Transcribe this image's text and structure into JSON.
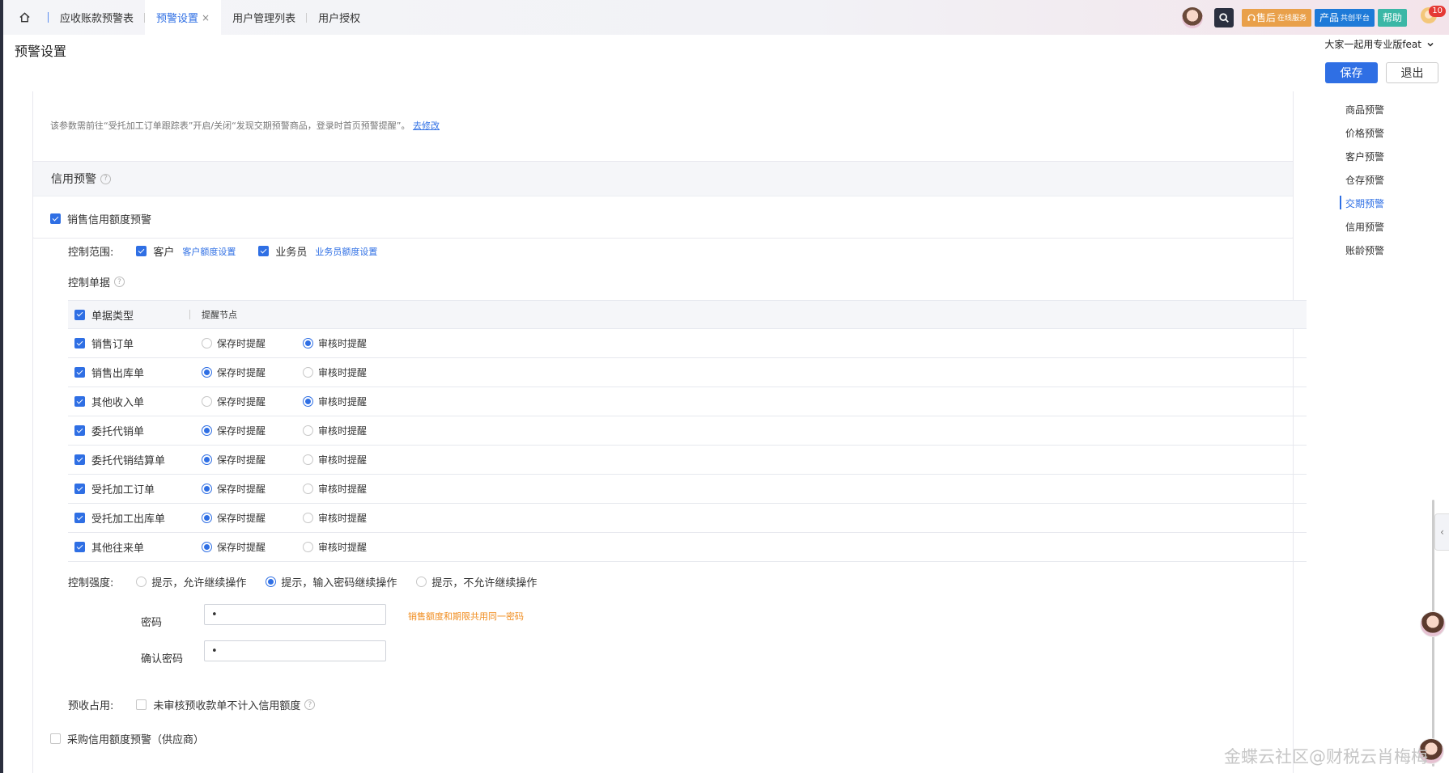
{
  "tabs": [
    {
      "label": "应收账款预警表",
      "active": false
    },
    {
      "label": "预警设置",
      "active": true,
      "close": "×"
    },
    {
      "label": "用户管理列表",
      "active": false
    },
    {
      "label": "用户授权",
      "active": false
    }
  ],
  "topright": {
    "service_label": "售后",
    "service_sub": "在线服务",
    "platform_label": "产品",
    "platform_sub": "共创平台",
    "help_label": "帮助",
    "badge_count": "10"
  },
  "header": {
    "title": "预警设置",
    "edition": "大家一起用专业版feat",
    "save": "保存",
    "exit": "退出"
  },
  "top_section": {
    "hint_text": "该参数需前往“受托加工订单跟踪表”开启/关闭“发现交期预警商品，登录时首页预警提醒”。",
    "hint_link": "去修改"
  },
  "credit": {
    "title": "信用预警",
    "sales_credit_label": "销售信用额度预警",
    "scope_label": "控制范围:",
    "customer_label": "客户",
    "customer_link": "客户额度设置",
    "salesman_label": "业务员",
    "salesman_link": "业务员额度设置",
    "doc_label": "控制单据",
    "table_head": {
      "type": "单据类型",
      "node": "提醒节点"
    },
    "option_save": "保存时提醒",
    "option_audit": "审核时提醒",
    "rows": [
      {
        "name": "销售订单",
        "checked": true,
        "choice": "audit"
      },
      {
        "name": "销售出库单",
        "checked": true,
        "choice": "save"
      },
      {
        "name": "其他收入单",
        "checked": true,
        "choice": "audit"
      },
      {
        "name": "委托代销单",
        "checked": true,
        "choice": "save"
      },
      {
        "name": "委托代销结算单",
        "checked": true,
        "choice": "save"
      },
      {
        "name": "受托加工订单",
        "checked": true,
        "choice": "save"
      },
      {
        "name": "受托加工出库单",
        "checked": true,
        "choice": "save"
      },
      {
        "name": "其他往来单",
        "checked": true,
        "choice": "save"
      }
    ],
    "strength_label": "控制强度:",
    "strength_options": [
      "提示，允许继续操作",
      "提示，输入密码继续操作",
      "提示，不允许继续操作"
    ],
    "strength_selected": 1,
    "password_label": "密码",
    "password_value": "•",
    "confirm_label": "确认密码",
    "confirm_value": "•",
    "password_hint": "销售额度和期限共用同一密码",
    "prepay_label": "预收占用:",
    "prepay_option": "未审核预收款单不计入信用额度",
    "purchase_credit_label": "采购信用额度预警（供应商）"
  },
  "side_nav": {
    "items": [
      "商品预警",
      "价格预警",
      "客户预警",
      "仓存预警",
      "交期预警",
      "信用预警",
      "账龄预警"
    ],
    "active_index": 4
  },
  "watermark": "金蝶云社区@财税云肖梅梅",
  "colors": {
    "primary": "#2f6fe4",
    "warning": "#f08c1e"
  }
}
